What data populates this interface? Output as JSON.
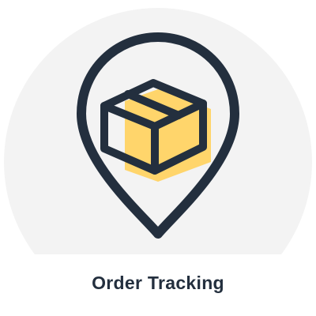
{
  "tile": {
    "label": "Order Tracking",
    "icon": "map-pin-with-package-icon",
    "colors": {
      "background": "#ffffff",
      "circle": "#f3f3f3",
      "outline": "#232f3e",
      "accent": "#ffd56b",
      "label": "#232f3e"
    }
  }
}
